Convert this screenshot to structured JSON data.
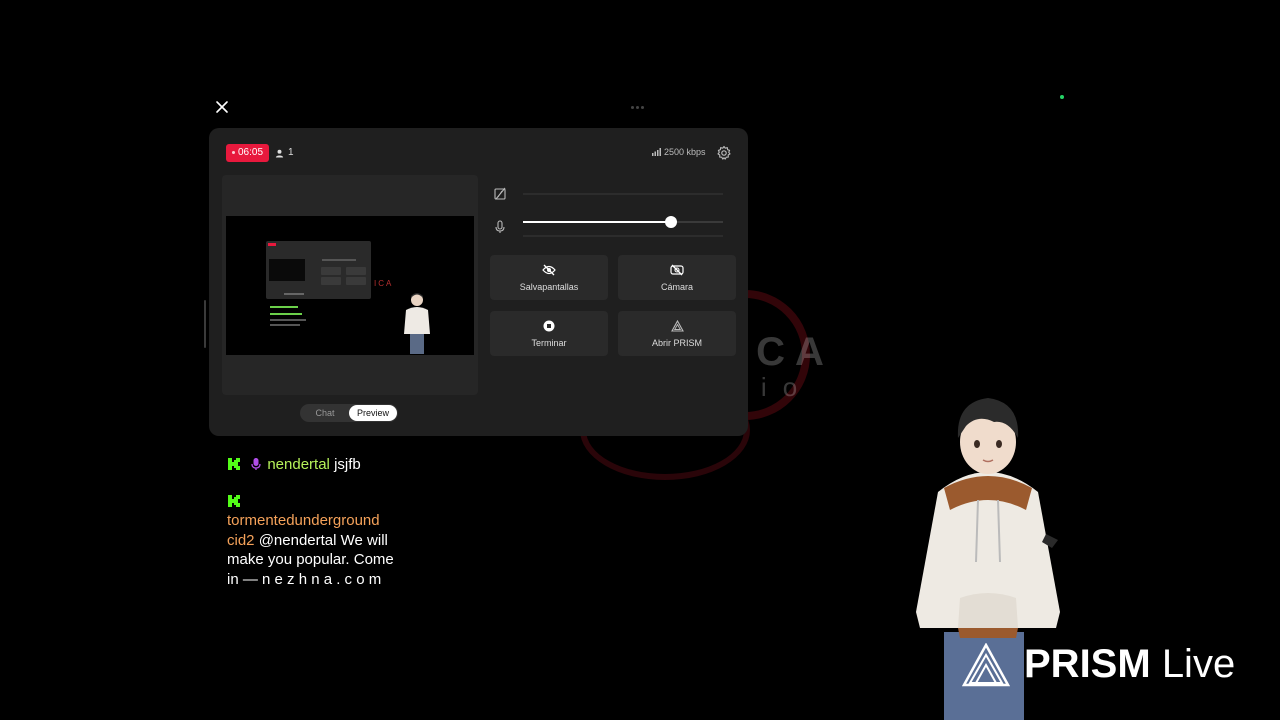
{
  "status": {
    "live_time": "06:05",
    "viewer_count": "1",
    "bitrate": "2500 kbps"
  },
  "controls": {
    "mic_volume": 0.74,
    "buttons": [
      {
        "label": "Salvapantallas",
        "icon": "eye-off-icon"
      },
      {
        "label": "Cámara",
        "icon": "camera-off-icon"
      },
      {
        "label": "Terminar",
        "icon": "stop-icon"
      },
      {
        "label": "Abrir PRISM",
        "icon": "prism-icon"
      }
    ]
  },
  "view_toggle": {
    "chat_label": "Chat",
    "preview_label": "Preview",
    "selected": "Preview"
  },
  "chat": {
    "messages": [
      {
        "platform_icon": "kick-icon",
        "badge_icon": "microphone-icon",
        "user": "nendertal",
        "text": "jsjfb",
        "user_color": "#b6f25a"
      },
      {
        "platform_icon": "kick-icon",
        "user": "tormentedunderground cid2",
        "text": "@nendertal We will make you popular. Come in — n e z h n a . c o m",
        "user_color": "#f5a25a"
      }
    ]
  },
  "background_brand": {
    "line1": "ICA",
    "line2": "udio"
  },
  "branding": {
    "prism_bold": "PRISM",
    "prism_light": "Live"
  },
  "colors": {
    "live_red": "#e8193d",
    "panel_bg": "#1f1f1f",
    "button_bg": "#2a2a2a",
    "kick_green": "#53fc18"
  }
}
